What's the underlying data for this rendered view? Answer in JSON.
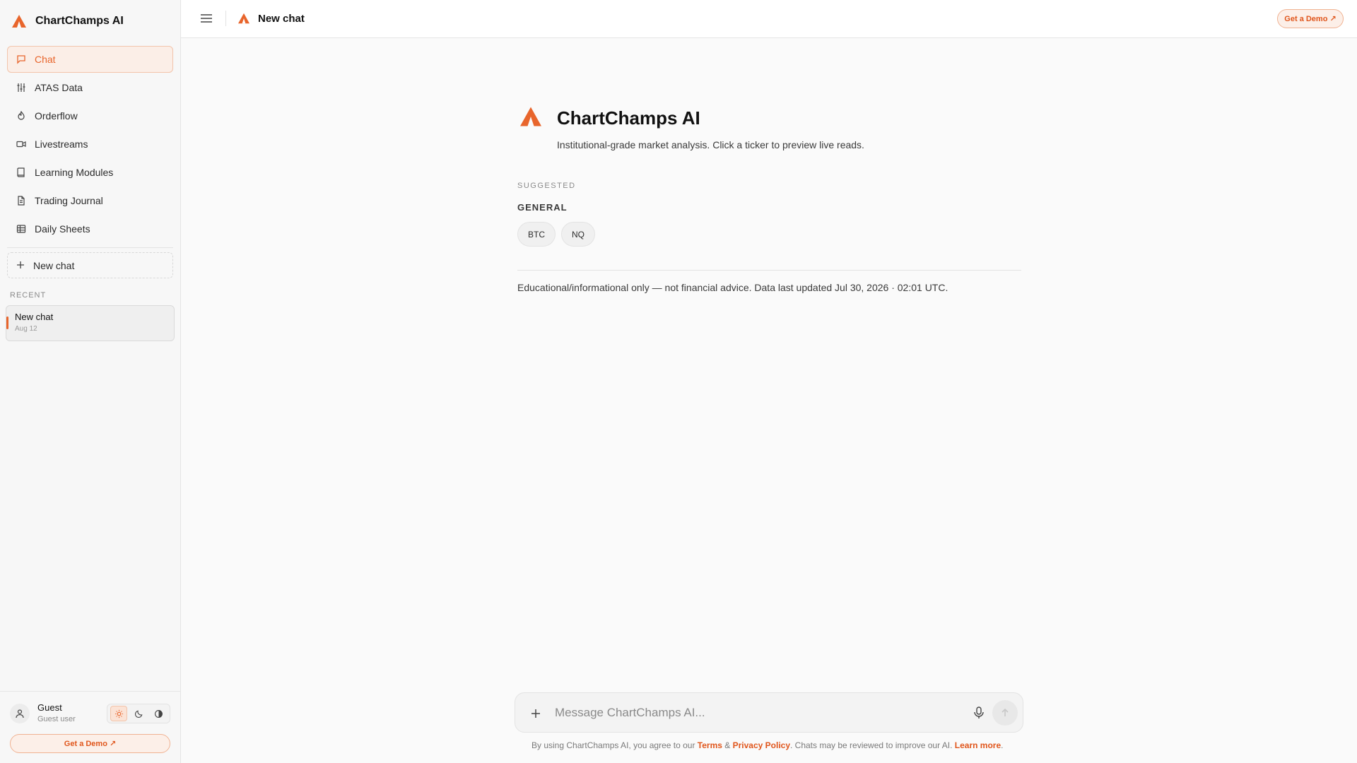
{
  "brand": {
    "name": "ChartChamps AI",
    "accent": "#e8652c"
  },
  "sidebar": {
    "items": [
      {
        "label": "Chat",
        "icon": "chat-bubble-icon",
        "active": true
      },
      {
        "label": "ATAS Data",
        "icon": "sliders-icon"
      },
      {
        "label": "Orderflow",
        "icon": "flame-icon"
      },
      {
        "label": "Livestreams",
        "icon": "video-icon"
      },
      {
        "label": "Learning Modules",
        "icon": "book-icon"
      },
      {
        "label": "Trading Journal",
        "icon": "document-icon"
      },
      {
        "label": "Daily Sheets",
        "icon": "table-icon"
      }
    ],
    "new_chat_label": "New chat",
    "recent_label": "RECENT",
    "recent": [
      {
        "title": "New chat",
        "date": "Aug 12"
      }
    ],
    "user": {
      "name": "Guest",
      "role": "Guest user"
    },
    "demo_label": "Get a Demo ↗"
  },
  "header": {
    "title": "New chat",
    "demo_label": "Get a Demo ↗"
  },
  "main": {
    "title": "ChartChamps AI",
    "subtitle": "Institutional-grade market analysis. Click a ticker to preview live reads.",
    "suggested_label": "SUGGESTED",
    "group_label": "GENERAL",
    "tickers": [
      "BTC",
      "NQ"
    ],
    "disclaimer": "Educational/informational only — not financial advice. Data last updated Jul 30, 2026 · 02:01 UTC."
  },
  "composer": {
    "placeholder": "Message ChartChamps AI..."
  },
  "footer": {
    "prefix": "By using ChartChamps AI, you agree to our ",
    "terms": "Terms",
    "amp": " & ",
    "privacy": "Privacy Policy",
    "middle": ". Chats may be reviewed to improve our AI. ",
    "learn_more": "Learn more",
    "suffix": "."
  }
}
